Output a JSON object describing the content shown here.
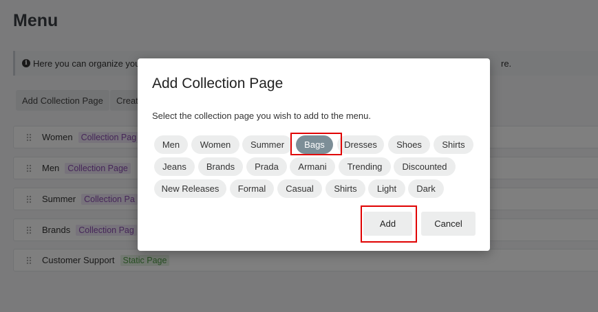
{
  "page": {
    "title": "Menu",
    "info_text": "Here you can organize your",
    "info_tail": "re."
  },
  "toolbar": {
    "add_collection_page": "Add Collection Page",
    "create_partial": "Creat"
  },
  "menu_items": [
    {
      "label": "Women",
      "tag": "Collection Pag"
    },
    {
      "label": "Men",
      "tag": "Collection Page"
    },
    {
      "label": "Summer",
      "tag": "Collection Pa"
    },
    {
      "label": "Brands",
      "tag": "Collection Pag"
    },
    {
      "label": "Customer Support",
      "tag": "Static Page"
    }
  ],
  "modal": {
    "title": "Add Collection Page",
    "subtitle": "Select the collection page you wish to add to the menu.",
    "chips": [
      "Men",
      "Women",
      "Summer",
      "Bags",
      "Dresses",
      "Shoes",
      "Shirts",
      "Jeans",
      "Brands",
      "Prada",
      "Armani",
      "Trending",
      "Discounted",
      "New Releases",
      "Formal",
      "Casual",
      "Shirts",
      "Light",
      "Dark"
    ],
    "selected_chip": "Bags",
    "add_label": "Add",
    "cancel_label": "Cancel"
  },
  "colors": {
    "selected_chip": "#7c8e97",
    "highlight": "#e00000",
    "collection_tag": "#8a4db0",
    "static_tag": "#4f9a45"
  }
}
